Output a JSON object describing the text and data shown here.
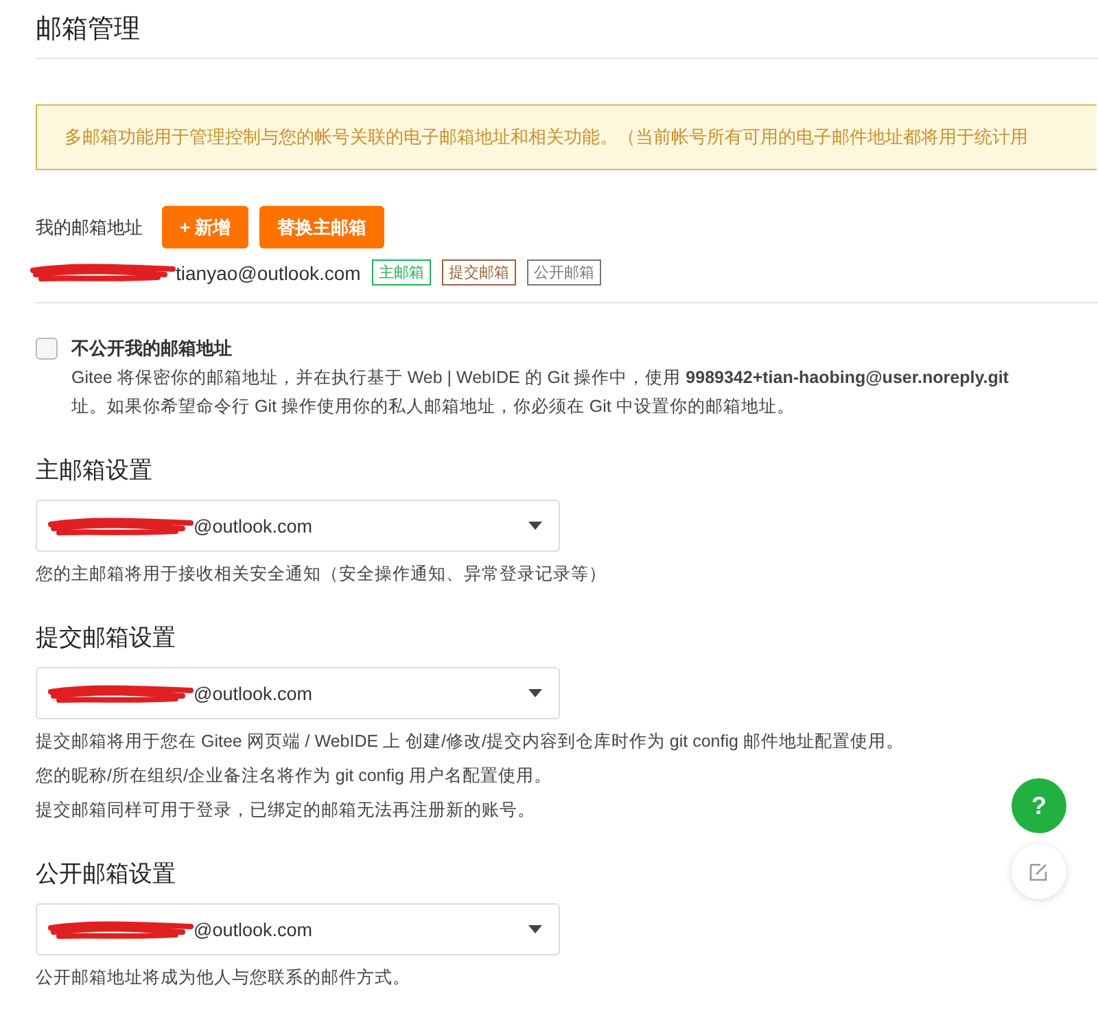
{
  "page_title": "邮箱管理",
  "notice": "多邮箱功能用于管理控制与您的帐号关联的电子邮箱地址和相关功能。（当前帐号所有可用的电子邮件地址都将用于统计用",
  "my_emails": {
    "label": "我的邮箱地址",
    "buttons": [
      {
        "label": "+ 新增"
      },
      {
        "label": "替换主邮箱"
      }
    ],
    "address": "tianyao@outlook.com",
    "tags": [
      {
        "label": "主邮箱",
        "color": "#21b351"
      },
      {
        "label": "提交邮箱",
        "color": "#a0613b"
      },
      {
        "label": "公开邮箱",
        "color": "#777777"
      }
    ]
  },
  "privacy": {
    "label": "不公开我的邮箱地址",
    "checked": false,
    "description_line_1": "Gitee 将保密你的邮箱地址，并在执行基于 Web | WebIDE 的 Git 操作中，使用 **9989342+tian-haobing@user.noreply.git**",
    "description_line_2": "址。如果你希望命令行 Git 操作使用你的私人邮箱地址，你必须在 Git 中设置你的邮箱地址。"
  },
  "sections": [
    {
      "title": "主邮箱设置",
      "value": "@outlook.com",
      "notes": [
        "您的主邮箱将用于接收相关安全通知（安全操作通知、异常登录记录等）"
      ]
    },
    {
      "title": "提交邮箱设置",
      "value": "@outlook.com",
      "notes": [
        "提交邮箱将用于您在 Gitee 网页端 / WebIDE 上 创建/修改/提交内容到仓库时作为 git config 邮件地址配置使用。",
        "您的昵称/所在组织/企业备注名将作为 git config 用户名配置使用。",
        "提交邮箱同样可用于登录，已绑定的邮箱无法再注册新的账号。"
      ]
    },
    {
      "title": "公开邮箱设置",
      "value": "@outlook.com",
      "notes": [
        "公开邮箱地址将成为他人与您联系的邮件方式。"
      ]
    }
  ],
  "help_button": {
    "label": "?"
  }
}
